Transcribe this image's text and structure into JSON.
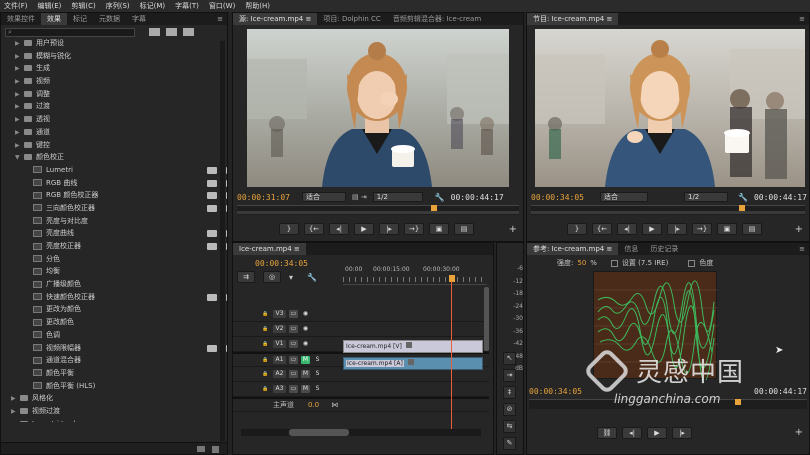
{
  "menu": [
    "文件(F)",
    "编辑(E)",
    "剪辑(C)",
    "序列(S)",
    "标记(M)",
    "字幕(T)",
    "窗口(W)",
    "帮助(H)"
  ],
  "effects_panel": {
    "tabs": [
      "效果控件",
      "效果",
      "标记",
      "元数据",
      "字幕"
    ],
    "tree": [
      {
        "label": "用户预设",
        "type": "folder"
      },
      {
        "label": "模糊与锐化",
        "type": "folder"
      },
      {
        "label": "生成",
        "type": "folder"
      },
      {
        "label": "视频",
        "type": "folder"
      },
      {
        "label": "调整",
        "type": "folder"
      },
      {
        "label": "过渡",
        "type": "folder"
      },
      {
        "label": "透视",
        "type": "folder"
      },
      {
        "label": "通道",
        "type": "folder"
      },
      {
        "label": "键控",
        "type": "folder"
      },
      {
        "label": "颜色校正",
        "type": "folder-open"
      },
      {
        "label": "Lumetri",
        "type": "effect",
        "badge": true
      },
      {
        "label": "RGB 曲线",
        "type": "effect",
        "badge": true
      },
      {
        "label": "RGB 颜色校正器",
        "type": "effect",
        "badge": true
      },
      {
        "label": "三向颜色校正器",
        "type": "effect",
        "badge": true
      },
      {
        "label": "亮度与对比度",
        "type": "effect",
        "badge": false
      },
      {
        "label": "亮度曲线",
        "type": "effect",
        "badge": true
      },
      {
        "label": "亮度校正器",
        "type": "effect",
        "badge": true
      },
      {
        "label": "分色",
        "type": "effect",
        "badge": false
      },
      {
        "label": "均衡",
        "type": "effect",
        "badge": false
      },
      {
        "label": "广播级颜色",
        "type": "effect",
        "badge": false
      },
      {
        "label": "快速颜色校正器",
        "type": "effect",
        "badge": true
      },
      {
        "label": "更改为颜色",
        "type": "effect",
        "badge": false
      },
      {
        "label": "更改颜色",
        "type": "effect",
        "badge": false
      },
      {
        "label": "色调",
        "type": "effect",
        "badge": false
      },
      {
        "label": "视频限幅器",
        "type": "effect",
        "badge": true
      },
      {
        "label": "通道混合器",
        "type": "effect",
        "badge": false
      },
      {
        "label": "颜色平衡",
        "type": "effect",
        "badge": false
      },
      {
        "label": "颜色平衡 (HLS)",
        "type": "effect",
        "badge": false
      },
      {
        "label": "风格化",
        "type": "folder"
      },
      {
        "label": "视频过渡",
        "type": "folder"
      },
      {
        "label": "Lumetri Looks",
        "type": "folder"
      }
    ]
  },
  "source_monitor": {
    "tabs": [
      "源: Ice-cream.mp4 ≡",
      "项目: Dolphin CC",
      "音频剪辑混合器: Ice-cream"
    ],
    "timecode_in": "00:00:31:07",
    "fit": "适合",
    "fraction": "1/2",
    "timecode_out": "00:00:44:17"
  },
  "program_monitor": {
    "tabs": [
      "节目: Ice-cream.mp4 ≡"
    ],
    "timecode_in": "00:00:34:05",
    "fit": "适合",
    "fraction": "1/2",
    "timecode_out": "00:00:44:17"
  },
  "timeline": {
    "tab": "Ice-cream.mp4 ≡",
    "timecode": "00:00:34:05",
    "ruler": [
      "00:00",
      "00:00:15:00",
      "00:00:30:00"
    ],
    "tracks": [
      {
        "name": "V3",
        "kind": "video"
      },
      {
        "name": "V2",
        "kind": "video"
      },
      {
        "name": "V1",
        "kind": "video"
      },
      {
        "name": "A1",
        "kind": "audio"
      },
      {
        "name": "A2",
        "kind": "audio"
      },
      {
        "name": "A3",
        "kind": "audio"
      }
    ],
    "master_label": "主声道",
    "master_value": "0.0",
    "clip_video": "Ice-cream.mp4 [V]",
    "clip_audio": "Ice-cream.mp4 [A]",
    "meter_ticks": [
      "-6",
      "-12",
      "-18",
      "-24",
      "-30",
      "-36",
      "-42",
      "-48",
      "dB"
    ]
  },
  "scope_panel": {
    "tabs": [
      "参考: Ice-cream.mp4 ≡",
      "信息",
      "历史记录"
    ],
    "brightness_label": "强度:",
    "brightness_value": "50",
    "brightness_unit": "%",
    "setup_label": "设置 (7.5 IRE)",
    "chroma_label": "色度",
    "timecode": "00:00:34:05",
    "timecode_out": "00:00:44:17"
  },
  "watermark": {
    "brand": "灵感中国",
    "url": "lingganchina.com"
  },
  "colors": {
    "accent": "#e8a43a",
    "bg": "#232323",
    "scope_green": "#3bd36a",
    "clip_video": "#c9c9d9",
    "clip_audio": "#5a8fb0"
  }
}
